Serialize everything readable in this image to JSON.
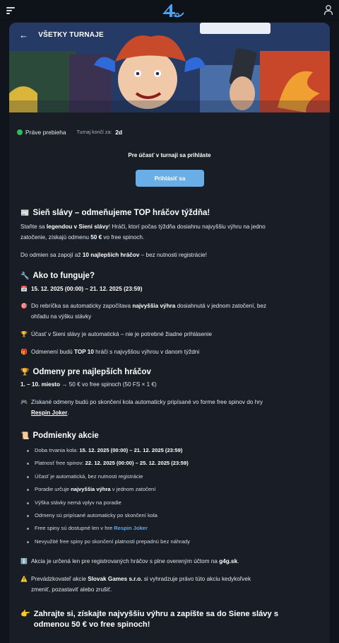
{
  "topbar": {
    "menu_icon": "hamburger-icon",
    "logo_text": "4",
    "user_icon": "user-icon"
  },
  "hero": {
    "back_label": "VŠETKY TURNAJE"
  },
  "status": {
    "live_label": "Práve prebieha",
    "ends_label": "Turnaj končí za:",
    "ends_value": "2d"
  },
  "login": {
    "note": "Pre účasť v turnaji sa prihláste",
    "button": "Prihlásiť sa"
  },
  "sections": {
    "intro": {
      "heading": "Sieň slávy – odmeňujeme TOP hráčov týždňa!",
      "p1_a": "Staňte sa ",
      "p1_b": "legendou v Sieni slávy",
      "p1_c": "! Hráči, ktorí počas týždňa dosiahnu najvyššiu výhru na jedno",
      "p1_d": "zatočenie, získajú odmenu ",
      "p1_e": "50 €",
      "p1_f": " vo free spinoch.",
      "p2_a": "Do odmien sa zapojí až ",
      "p2_b": "10 najlepších hráčov",
      "p2_c": " – bez nutnosti registrácie!"
    },
    "how": {
      "heading": "Ako to funguje?",
      "dates": "15. 12. 2025 (00:00) – 21. 12. 2025 (23:59)",
      "r1_a": "Do rebríčka sa automaticky započítava ",
      "r1_b": "najvyššia výhra",
      "r1_c": " dosiahnutá v jednom zatočení, bez",
      "r1_d": "ohľadu na výšku stávky",
      "r2": "Účasť v Sieni slávy je automatická – nie je potrebné žiadne prihlásenie",
      "r3_a": "Odmenení budú ",
      "r3_b": "TOP 10",
      "r3_c": " hráči s najvyššou výhrou v danom týždni"
    },
    "rewards": {
      "heading": "Odmeny pre najlepších hráčov",
      "line_a": "1. – 10. miesto",
      "line_b": " → 50 € vo free spinoch (50 FS × 1 €)",
      "note_a": "Získané odmeny budú po skončení kola automaticky pripísané vo forme free spinov do hry",
      "note_link": "Respin Joker",
      "note_end": "."
    },
    "conditions": {
      "heading": "Podmienky akcie",
      "b1_a": "Doba trvania kola: ",
      "b1_b": "15. 12. 2025 (00:00) – 21. 12. 2025 (23:59)",
      "b2_a": "Platnosť free spinov: ",
      "b2_b": "22. 12. 2025 (00:00) – 25. 12. 2025 (23:59)",
      "b3": "Účasť je automatická, bez nutnosti registrácie",
      "b4_a": "Poradie určuje ",
      "b4_b": "najvyššia výhra",
      "b4_c": " v jednom zatočení",
      "b5": "Výška stávky nemá vplyv na poradie",
      "b6": "Odmeny sú pripísané automaticky po skončení kola",
      "b7_a": "Free spiny sú dostupné len v hre ",
      "b7_b": "Respin Joker",
      "b8": "Nevyužité free spiny po skončení platnosti prepadnú bez náhrady",
      "info_a": "Akcia je určená len pre registrovaných hráčov s plne overeným účtom na ",
      "info_b": "g4g.sk",
      "info_c": ".",
      "warn_a": "Prevádzkovateľ akcie ",
      "warn_b": "Slovak Games s.r.o.",
      "warn_c": " si vyhradzuje právo túto akciu kedykoľvek",
      "warn_d": "zmeniť, pozastaviť alebo zrušiť."
    },
    "final": {
      "line1": "Zahrajte si, získajte najvyššiu výhru a zapíšte sa do Siene slávy s",
      "line2": "odmenou 50 € vo free spinoch!"
    }
  },
  "colors": {
    "accent": "#6aaee8",
    "live": "#2fbf5a",
    "link": "#58a9ee"
  }
}
